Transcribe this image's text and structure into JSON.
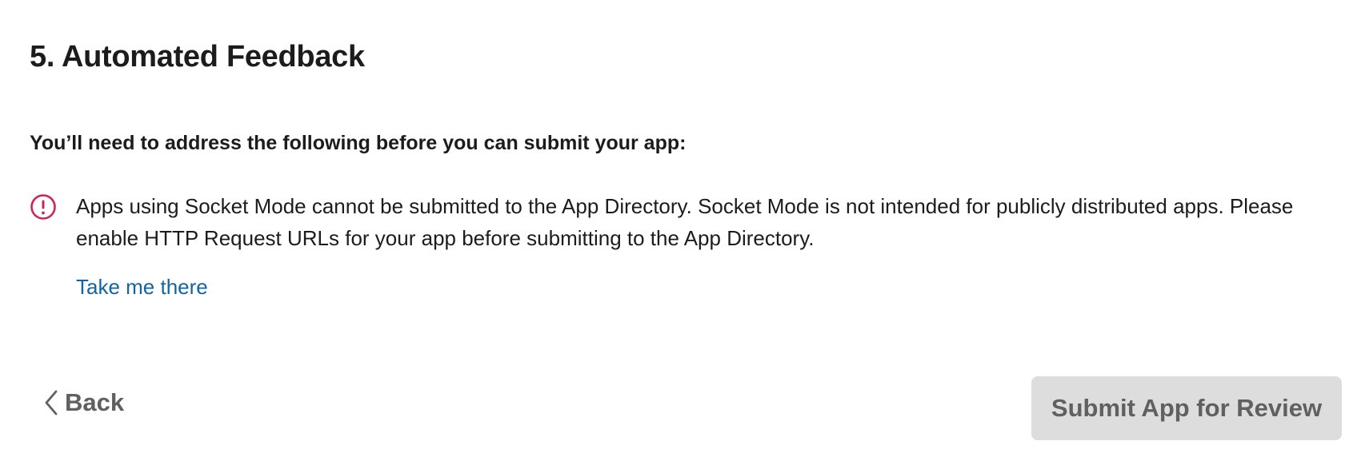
{
  "section": {
    "title": "5. Automated Feedback"
  },
  "intro": {
    "text": "You’ll need to address the following before you can submit your app:"
  },
  "issues": [
    {
      "icon": "alert-circle-icon",
      "icon_color": "#cd2553",
      "text": "Apps using Socket Mode cannot be submitted to the App Directory. Socket Mode is not intended for publicly distributed apps. Please enable HTTP Request URLs for your app before submitting to the App Directory.",
      "link_label": "Take me there",
      "link_color": "#1264a3"
    }
  ],
  "footer": {
    "back_label": "Back",
    "back_icon": "chevron-left-icon",
    "submit_label": "Submit App for Review",
    "submit_disabled": true,
    "submit_bg": "#dddddd"
  }
}
